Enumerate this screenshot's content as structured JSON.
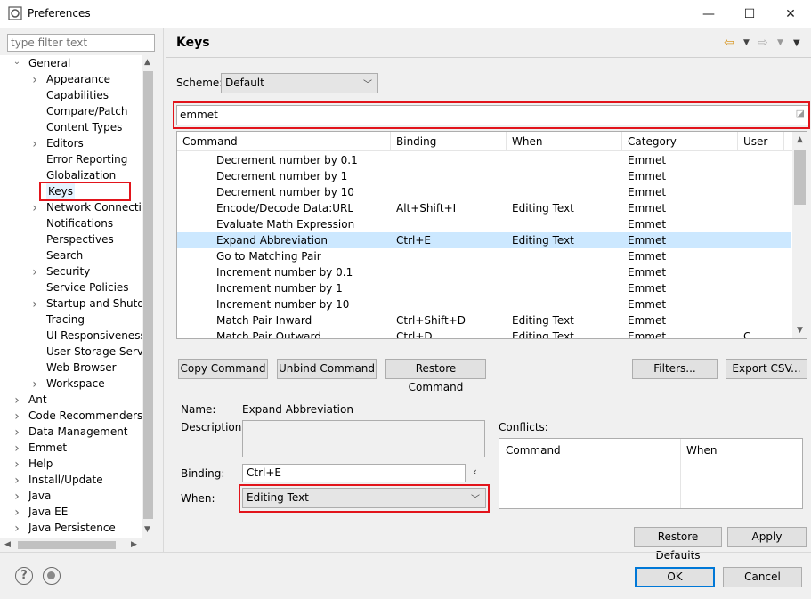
{
  "window": {
    "title": "Preferences",
    "controls": {
      "minimize": "—",
      "maximize": "☐",
      "close": "✕"
    }
  },
  "sidebar": {
    "filter_placeholder": "type filter text",
    "tree": [
      {
        "label": "General",
        "level": 0,
        "toggle": "expanded"
      },
      {
        "label": "Appearance",
        "level": 1,
        "toggle": "collapsed"
      },
      {
        "label": "Capabilities",
        "level": 1,
        "toggle": "none"
      },
      {
        "label": "Compare/Patch",
        "level": 1,
        "toggle": "none"
      },
      {
        "label": "Content Types",
        "level": 1,
        "toggle": "none"
      },
      {
        "label": "Editors",
        "level": 1,
        "toggle": "collapsed"
      },
      {
        "label": "Error Reporting",
        "level": 1,
        "toggle": "none"
      },
      {
        "label": "Globalization",
        "level": 1,
        "toggle": "none"
      },
      {
        "label": "Keys",
        "level": 1,
        "toggle": "none",
        "selected": true
      },
      {
        "label": "Network Connection",
        "level": 1,
        "toggle": "collapsed"
      },
      {
        "label": "Notifications",
        "level": 1,
        "toggle": "none"
      },
      {
        "label": "Perspectives",
        "level": 1,
        "toggle": "none"
      },
      {
        "label": "Search",
        "level": 1,
        "toggle": "none"
      },
      {
        "label": "Security",
        "level": 1,
        "toggle": "collapsed"
      },
      {
        "label": "Service Policies",
        "level": 1,
        "toggle": "none"
      },
      {
        "label": "Startup and Shutdown",
        "level": 1,
        "toggle": "collapsed"
      },
      {
        "label": "Tracing",
        "level": 1,
        "toggle": "none"
      },
      {
        "label": "UI Responsiveness M",
        "level": 1,
        "toggle": "none"
      },
      {
        "label": "User Storage Service",
        "level": 1,
        "toggle": "none"
      },
      {
        "label": "Web Browser",
        "level": 1,
        "toggle": "none"
      },
      {
        "label": "Workspace",
        "level": 1,
        "toggle": "collapsed"
      },
      {
        "label": "Ant",
        "level": 0,
        "toggle": "collapsed"
      },
      {
        "label": "Code Recommenders",
        "level": 0,
        "toggle": "collapsed"
      },
      {
        "label": "Data Management",
        "level": 0,
        "toggle": "collapsed"
      },
      {
        "label": "Emmet",
        "level": 0,
        "toggle": "collapsed"
      },
      {
        "label": "Help",
        "level": 0,
        "toggle": "collapsed"
      },
      {
        "label": "Install/Update",
        "level": 0,
        "toggle": "collapsed"
      },
      {
        "label": "Java",
        "level": 0,
        "toggle": "collapsed"
      },
      {
        "label": "Java EE",
        "level": 0,
        "toggle": "collapsed"
      },
      {
        "label": "Java Persistence",
        "level": 0,
        "toggle": "collapsed"
      }
    ]
  },
  "page": {
    "heading": "Keys",
    "scheme_label": "Scheme:",
    "scheme_value": "Default",
    "search_value": "emmet",
    "columns": [
      "Command",
      "Binding",
      "When",
      "Category",
      "User"
    ],
    "rows": [
      {
        "command": "Decrement number by 0.1",
        "binding": "",
        "when": "",
        "category": "Emmet",
        "user": ""
      },
      {
        "command": "Decrement number by 1",
        "binding": "",
        "when": "",
        "category": "Emmet",
        "user": ""
      },
      {
        "command": "Decrement number by 10",
        "binding": "",
        "when": "",
        "category": "Emmet",
        "user": ""
      },
      {
        "command": "Encode/Decode Data:URL",
        "binding": "Alt+Shift+I",
        "when": "Editing Text",
        "category": "Emmet",
        "user": ""
      },
      {
        "command": "Evaluate Math Expression",
        "binding": "",
        "when": "",
        "category": "Emmet",
        "user": ""
      },
      {
        "command": "Expand Abbreviation",
        "binding": "Ctrl+E",
        "when": "Editing Text",
        "category": "Emmet",
        "user": "",
        "selected": true
      },
      {
        "command": "Go to Matching Pair",
        "binding": "",
        "when": "",
        "category": "Emmet",
        "user": ""
      },
      {
        "command": "Increment number by 0.1",
        "binding": "",
        "when": "",
        "category": "Emmet",
        "user": ""
      },
      {
        "command": "Increment number by 1",
        "binding": "",
        "when": "",
        "category": "Emmet",
        "user": ""
      },
      {
        "command": "Increment number by 10",
        "binding": "",
        "when": "",
        "category": "Emmet",
        "user": ""
      },
      {
        "command": "Match Pair Inward",
        "binding": "Ctrl+Shift+D",
        "when": "Editing Text",
        "category": "Emmet",
        "user": ""
      },
      {
        "command": "Match Pair Outward",
        "binding": "Ctrl+D",
        "when": "Editing Text",
        "category": "Emmet",
        "user": "C"
      }
    ],
    "buttons": {
      "copy": "Copy Command",
      "unbind": "Unbind Command",
      "restore": "Restore Command",
      "filters": "Filters...",
      "export": "Export CSV..."
    },
    "details": {
      "name_label": "Name:",
      "name_value": "Expand Abbreviation",
      "description_label": "Description:",
      "binding_label": "Binding:",
      "binding_value": "Ctrl+E",
      "when_label": "When:",
      "when_value": "Editing Text",
      "conflicts_label": "Conflicts:",
      "conflicts_columns": [
        "Command",
        "When"
      ]
    },
    "restore_defaults": "Restore Defaults",
    "apply": "Apply"
  },
  "footer": {
    "ok": "OK",
    "cancel": "Cancel"
  },
  "colors": {
    "highlight": "#e2141b",
    "selection": "#cce8ff",
    "primary_border": "#0078d7"
  }
}
